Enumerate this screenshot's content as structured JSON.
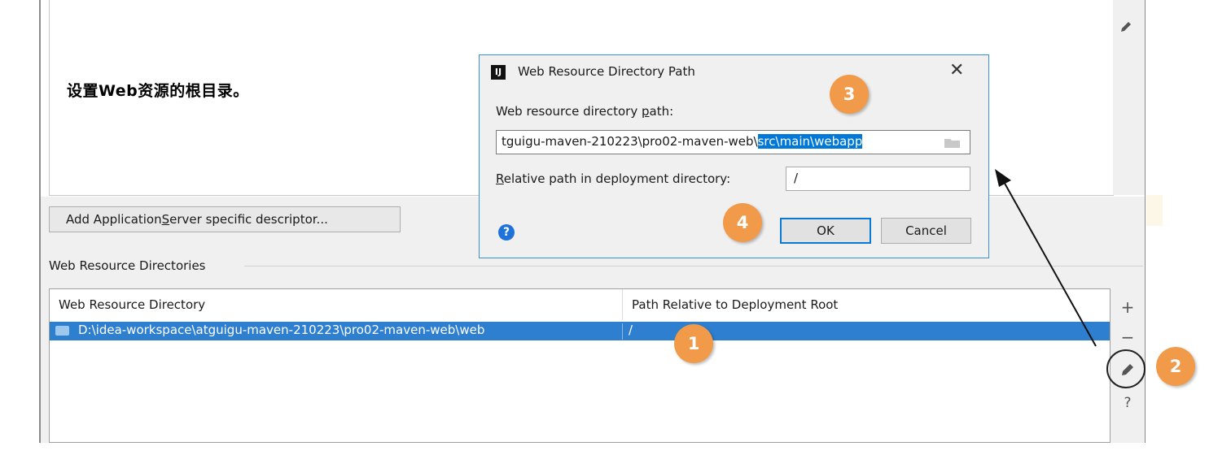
{
  "description": {
    "text": "设置Web资源的根目录。"
  },
  "buttons": {
    "add_descriptor_prefix": "Add Application ",
    "add_descriptor_mnemonic": "S",
    "add_descriptor_suffix": "erver specific descriptor..."
  },
  "section": {
    "label": "Web Resource Directories"
  },
  "table": {
    "columns": [
      "Web Resource Directory",
      "Path Relative to Deployment Root"
    ],
    "rows": [
      {
        "directory": "D:\\idea-workspace\\atguigu-maven-210223\\pro02-maven-web\\web",
        "relative_path": "/"
      }
    ]
  },
  "toolbar": {
    "add": "+",
    "remove": "−",
    "edit": "✎",
    "help": "?"
  },
  "dialog": {
    "icon_text": "IJ",
    "title": "Web Resource Directory Path",
    "close": "✕",
    "path_label_prefix": "Web resource directory ",
    "path_label_mnemonic": "p",
    "path_label_suffix": "ath:",
    "path_value_plain": "tguigu-maven-210223\\pro02-maven-web\\",
    "path_value_selected": "src\\main\\webapp",
    "relative_label_mnemonic": "R",
    "relative_label_suffix": "elative path in deployment directory:",
    "relative_value": "/",
    "help": "?",
    "ok": "OK",
    "cancel": "Cancel"
  },
  "callouts": [
    "1",
    "2",
    "3",
    "4"
  ],
  "colors": {
    "selection": "#2f7fd0",
    "callout": "#f09a4a",
    "dialog_border": "#3c8fd9"
  }
}
